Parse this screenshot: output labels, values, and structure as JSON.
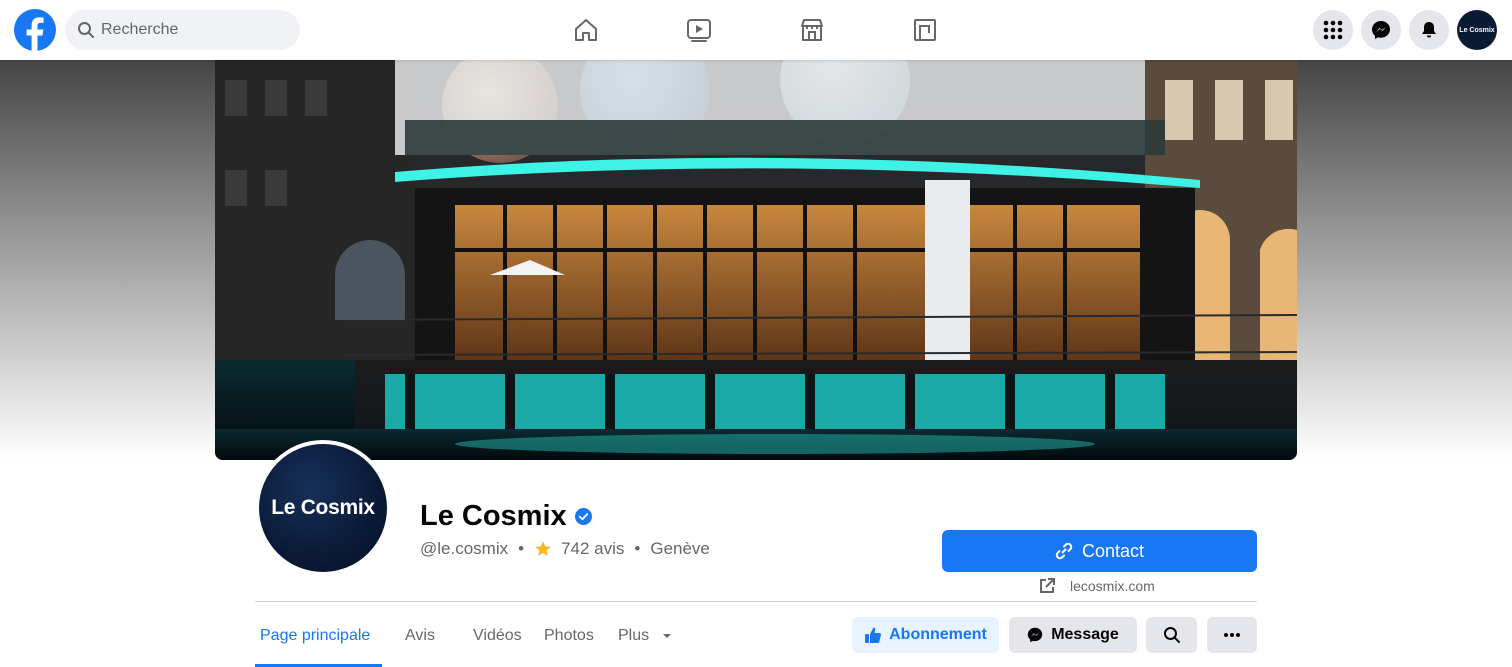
{
  "topbar": {
    "search_placeholder": "Recherche",
    "nav_icons": [
      "home-icon",
      "video-icon",
      "marketplace-icon",
      "pages-icon"
    ],
    "account_label": "Le Cosmix"
  },
  "profile": {
    "avatar_text": "Le Cosmix",
    "name": "Le Cosmix",
    "handle": "@le.cosmix",
    "reviews": "742 avis",
    "location": "Genève",
    "separator": "•"
  },
  "actions": {
    "contact_label": "Contact",
    "website": "lecosmix.com",
    "follow_label": "Abonnement",
    "message_label": "Message"
  },
  "tabs": [
    {
      "label": "Page principale",
      "active": true
    },
    {
      "label": "Avis"
    },
    {
      "label": "Vidéos"
    },
    {
      "label": "Photos"
    },
    {
      "label": "Plus"
    }
  ],
  "colors": {
    "accent": "#1877f2",
    "star": "#f7b928",
    "muted": "#65676b"
  }
}
